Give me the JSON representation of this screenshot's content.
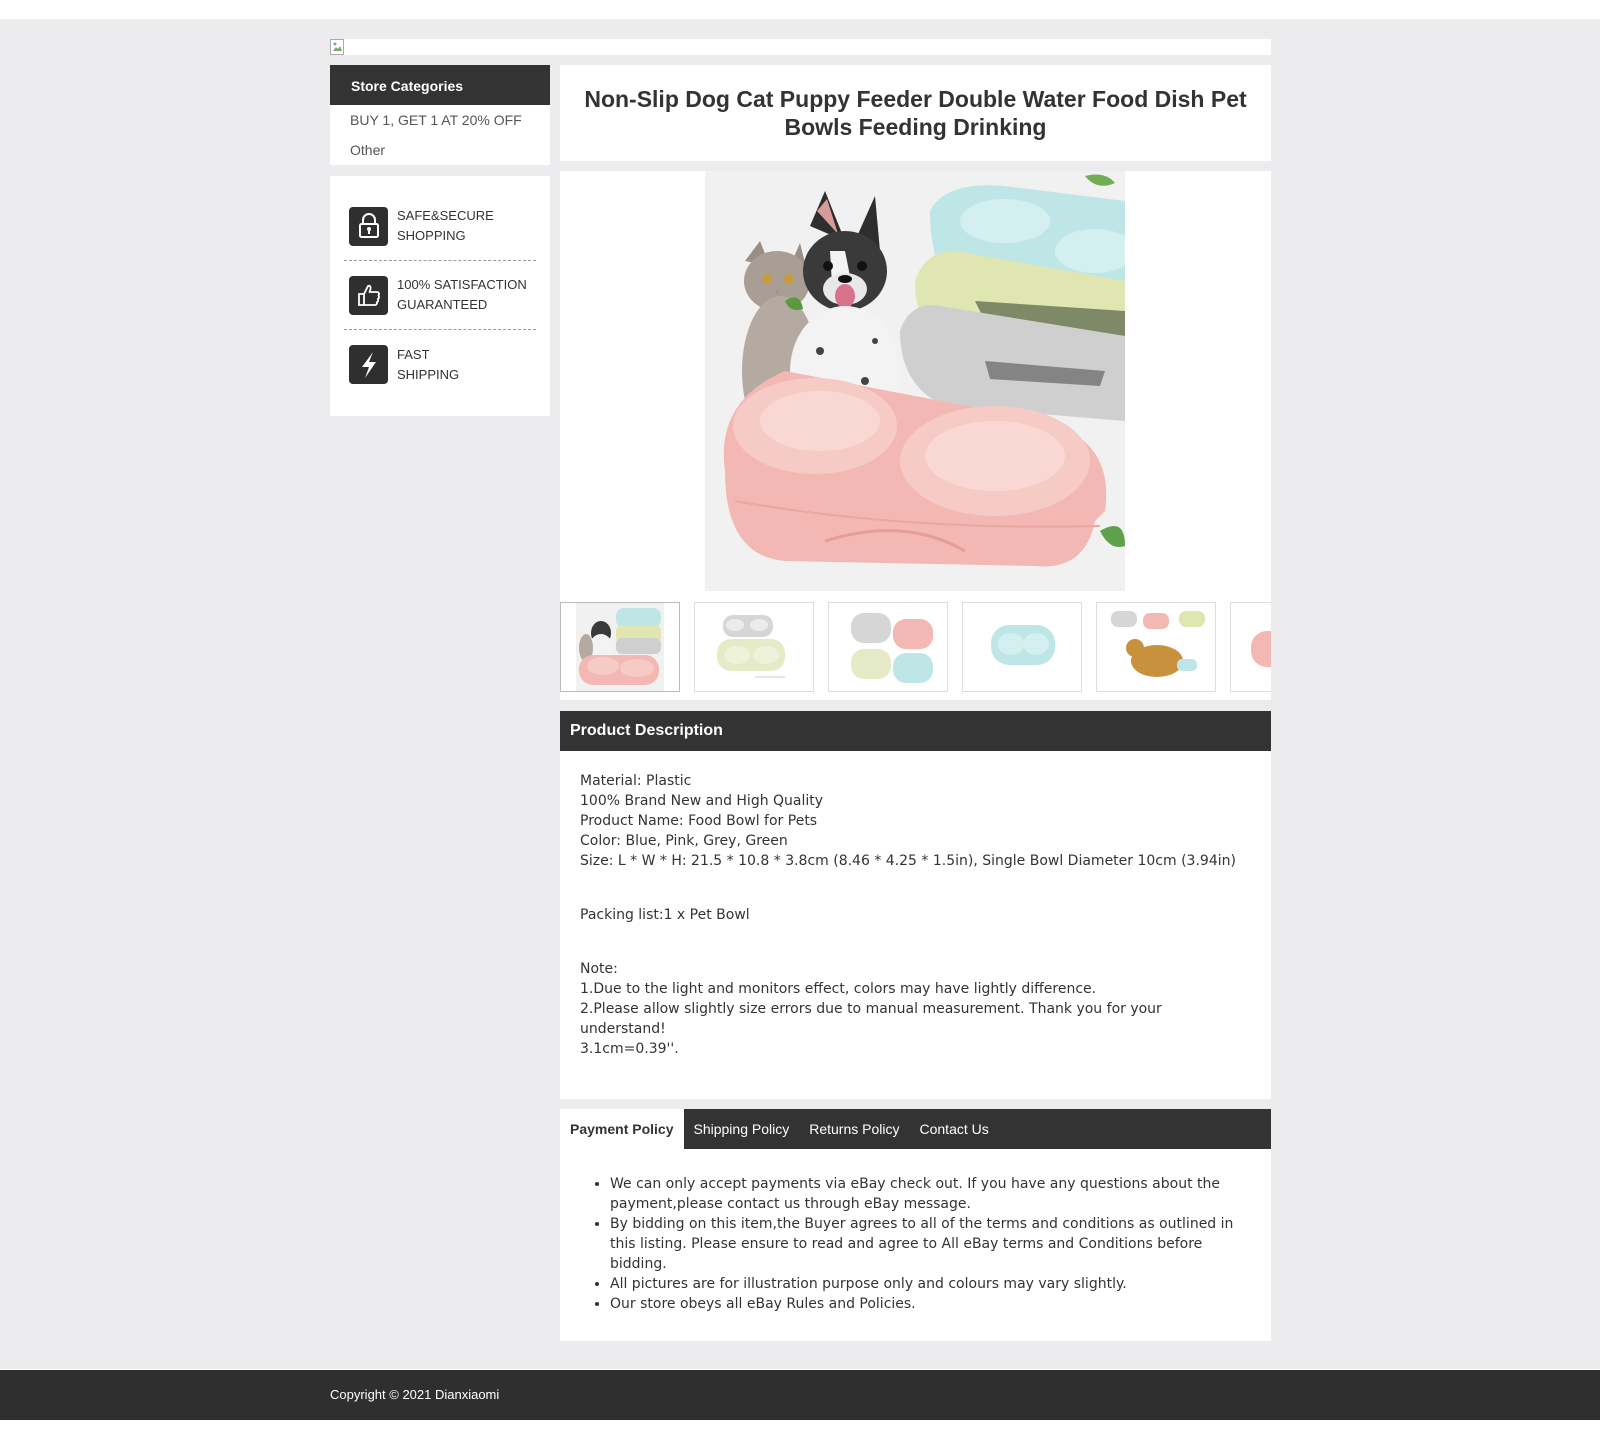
{
  "sidebar": {
    "categories_heading": "Store Categories",
    "categories": [
      "BUY 1, GET 1 AT 20% OFF",
      "Other"
    ],
    "trust": [
      {
        "icon": "lock-icon",
        "line1": "SAFE&SECURE",
        "line2": "SHOPPING"
      },
      {
        "icon": "thumbs-up-icon",
        "line1": "100% SATISFACTION",
        "line2": "GUARANTEED"
      },
      {
        "icon": "lightning-icon",
        "line1": "FAST",
        "line2": "SHIPPING"
      }
    ]
  },
  "product": {
    "title": "Non-Slip Dog Cat Puppy Feeder Double Water Food Dish Pet Bowls Feeding Drinking"
  },
  "description": {
    "heading": "Product Description",
    "lines": [
      "Material: Plastic",
      "100% Brand New and High Quality",
      "Product Name: Food Bowl for Pets",
      "Color: Blue, Pink, Grey, Green",
      "Size: L * W * H: 21.5 * 10.8 * 3.8cm (8.46 * 4.25 * 1.5in), Single Bowl Diameter 10cm (3.94in)"
    ],
    "packing": "Packing list:1 x Pet Bowl",
    "note_heading": "Note:",
    "notes": [
      "1.Due to the light and monitors effect, colors may have lightly difference.",
      "2.Please allow slightly size errors due to manual measurement. Thank you for your understand!",
      "3.1cm=0.39''."
    ]
  },
  "tabs": {
    "items": [
      "Payment Policy",
      "Shipping Policy",
      "Returns Policy",
      "Contact Us"
    ],
    "payment_points": [
      "We can only accept payments via eBay check out. If you have any questions about the payment,please contact us through eBay message.",
      "By bidding on this item,the Buyer agrees to all of the terms and conditions as outlined in this listing. Please ensure to read and agree to All eBay terms and Conditions before bidding.",
      "All pictures are for illustration purpose only and colours may vary slightly.",
      "Our store obeys all eBay Rules and Policies."
    ]
  },
  "footer": {
    "copyright": "Copyright © 2021 Dianxiaomi"
  },
  "colors": {
    "dark": "#333333",
    "page_bg": "#ecebee",
    "pink_bowl": "#f3b8b3",
    "blue_bowl": "#bfe6e6",
    "green_bowl": "#dfe6b1",
    "grey_bowl": "#cfcfcf"
  }
}
